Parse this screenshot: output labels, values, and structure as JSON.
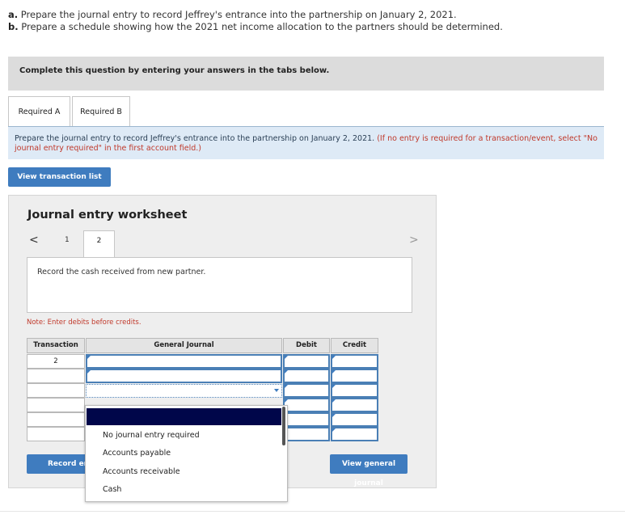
{
  "question": {
    "part_a_letter": "a.",
    "part_a_text": "Prepare the journal entry to record Jeffrey's entrance into the partnership on January 2, 2021.",
    "part_b_letter": "b.",
    "part_b_text": "Prepare a schedule showing how the 2021 net income allocation to the partners should be determined."
  },
  "banner": {
    "text": "Complete this question by entering your answers in the tabs below."
  },
  "tabs": [
    {
      "label": "Required A"
    },
    {
      "label": "Required B"
    }
  ],
  "instruction": {
    "text": "Prepare the journal entry to record Jeffrey's entrance into the partnership on January 2, 2021.",
    "note": "(If no entry is required for a transaction/event, select \"No journal entry required\" in the first account field.)"
  },
  "buttons": {
    "view_transaction_list": "View transaction list",
    "record_entry": "Record entry",
    "view_general_journal": "View general journal"
  },
  "worksheet": {
    "title": "Journal entry worksheet",
    "prev_symbol": "<",
    "next_symbol": ">",
    "pages": [
      "1",
      "2"
    ],
    "current_page": "2",
    "description": "Record the cash received from new partner.",
    "note": "Note: Enter debits before credits.",
    "columns": {
      "transaction": "Transaction",
      "general_journal": "General Journal",
      "debit": "Debit",
      "credit": "Credit"
    },
    "rows": [
      {
        "transaction": "2",
        "account": "",
        "debit": "",
        "credit": ""
      },
      {
        "transaction": "",
        "account": "",
        "debit": "",
        "credit": ""
      },
      {
        "transaction": "",
        "account": "",
        "debit": "",
        "credit": ""
      },
      {
        "transaction": "",
        "account": "",
        "debit": "",
        "credit": ""
      },
      {
        "transaction": "",
        "account": "",
        "debit": "",
        "credit": ""
      },
      {
        "transaction": "",
        "account": "",
        "debit": "",
        "credit": ""
      }
    ]
  },
  "dropdown": {
    "options": [
      "No journal entry required",
      "Accounts payable",
      "Accounts receivable",
      "Cash"
    ]
  },
  "colors": {
    "accent": "#3f7cbf",
    "highlight": "#00064a",
    "note_red": "#c0392b",
    "instruction_bg": "#deeaf6"
  }
}
